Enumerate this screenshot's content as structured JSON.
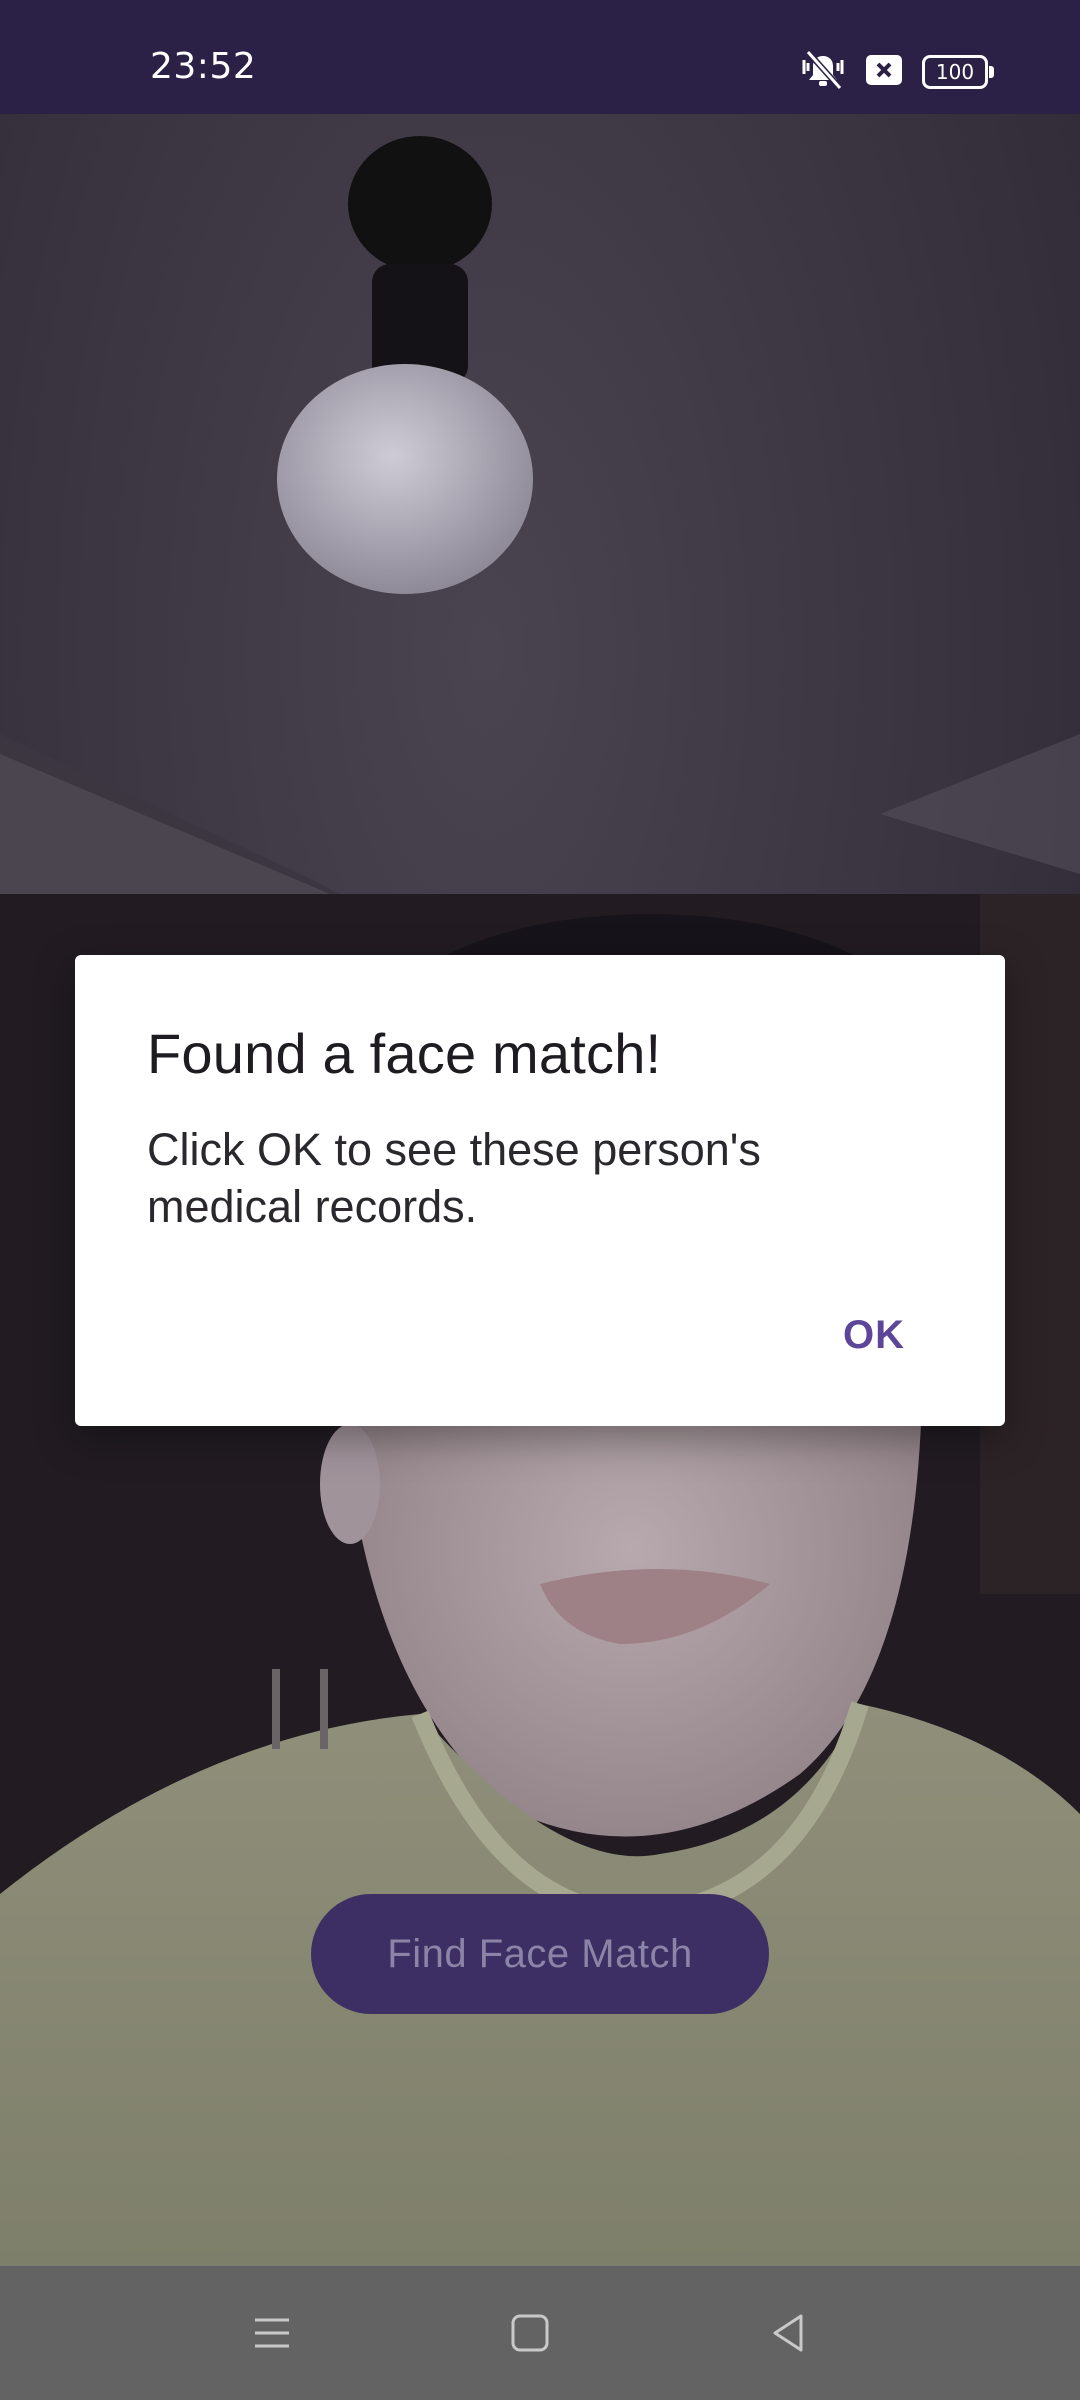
{
  "status_bar": {
    "time": "23:52",
    "icons": [
      "vibrate-off-icon",
      "notification-x-icon",
      "battery-icon"
    ],
    "battery_level": "100"
  },
  "camera_preview": {
    "find_button_label": "Find Face Match"
  },
  "dialog": {
    "title": "Found a face match!",
    "message": "Click OK to see these person's medical records.",
    "ok_label": "OK"
  },
  "nav_bar": {
    "buttons": [
      "menu-icon",
      "home-icon",
      "back-icon"
    ]
  },
  "colors": {
    "status_bar": "#2b2046",
    "accent": "#5b4699",
    "button_bg": "#3d2f64",
    "nav_bar": "#636363"
  }
}
